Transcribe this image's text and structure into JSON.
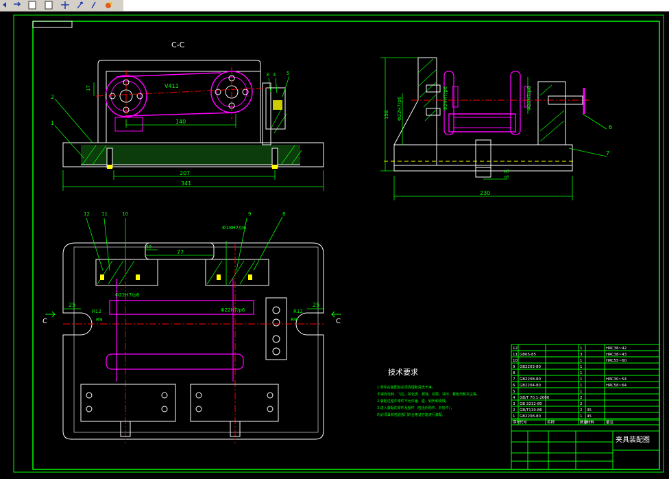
{
  "toolbar": {
    "icons": [
      "undo-icon",
      "redo-icon",
      "new-icon",
      "open-icon",
      "move-icon",
      "rotate-icon",
      "stretch-icon",
      "paint-icon"
    ]
  },
  "drawing": {
    "section_title": "C-C",
    "dims_top_view": {
      "d207": "207",
      "d341": "341",
      "d140": "140",
      "d17": "17",
      "label_v": "V411"
    },
    "dims_side_view": {
      "d230": "230",
      "d158": "158",
      "fit1": "Φ22H7/p6",
      "fit2": "Φ24H7/p6",
      "fit3": "Φ20H7/p6",
      "h7": "H7",
      "n6": "n6"
    },
    "dims_plan_view": {
      "d25a": "25",
      "d25b": "25",
      "d77": "77",
      "d30": "30",
      "fit_a": "Φ18H7/p6",
      "fit_b": "Φ22H7/p6",
      "fit_c": "Φ22H7/p6",
      "r9a": "R9",
      "r12a": "R12",
      "r9b": "R9",
      "r12b": "R12"
    },
    "balloons": [
      "1",
      "2",
      "3",
      "4",
      "5",
      "6",
      "7",
      "8",
      "9",
      "10",
      "11",
      "12"
    ],
    "section_marker": "C",
    "tech_title": "技术要求",
    "tech_lines": [
      "1.零件在装配前必须清理和清洗干净，",
      "  不得有毛刺、飞边、氧化皮、锈蚀、切屑、油污、着色剂和灰尘等。",
      "2.装配过程中零件不允许磕、碰、划伤和锈蚀。",
      "3.进入装配的零件及部件（包括外购件、外协件），",
      "  均必须具有检验部门的合格证方能进行装配。"
    ],
    "bom_rows": [
      [
        "12",
        "",
        "",
        "1",
        "",
        "HRC38~42"
      ],
      [
        "11",
        "GB65-85",
        "",
        "3",
        "",
        "HRC38~43"
      ],
      [
        "10",
        "",
        "",
        "1",
        "",
        "HRC55~60"
      ],
      [
        "9",
        "GB2203-80",
        "",
        "1",
        "",
        ""
      ],
      [
        "8",
        "",
        "",
        "1",
        "",
        ""
      ],
      [
        "7",
        "GB2208-80",
        "",
        "1",
        "",
        "HRC30~54"
      ],
      [
        "6",
        "GB2204-80",
        "",
        "1",
        "",
        "HRC58~64"
      ],
      [
        "5",
        "",
        "",
        "1",
        "",
        ""
      ],
      [
        "4",
        "GB/T 70.1-2000",
        "",
        "2",
        "",
        ""
      ],
      [
        "3",
        "GB 2212-80",
        "",
        "2",
        "",
        ""
      ],
      [
        "2",
        "GB/T119-86",
        "",
        "2",
        "35",
        ""
      ],
      [
        "1",
        "GB2208-80",
        "",
        "1",
        "45",
        ""
      ]
    ],
    "bom_header": [
      "序号",
      "代号",
      "名称",
      "数量",
      "材料",
      "备注"
    ],
    "title_block": "夹具装配图"
  },
  "colors": {
    "frame": "#00ff00",
    "line": "#ffffff",
    "center": "#ff0000",
    "part": "#ff00ff",
    "hatch": "#00ff00",
    "fill": "#ffff00",
    "cyan": "#00ffff"
  }
}
